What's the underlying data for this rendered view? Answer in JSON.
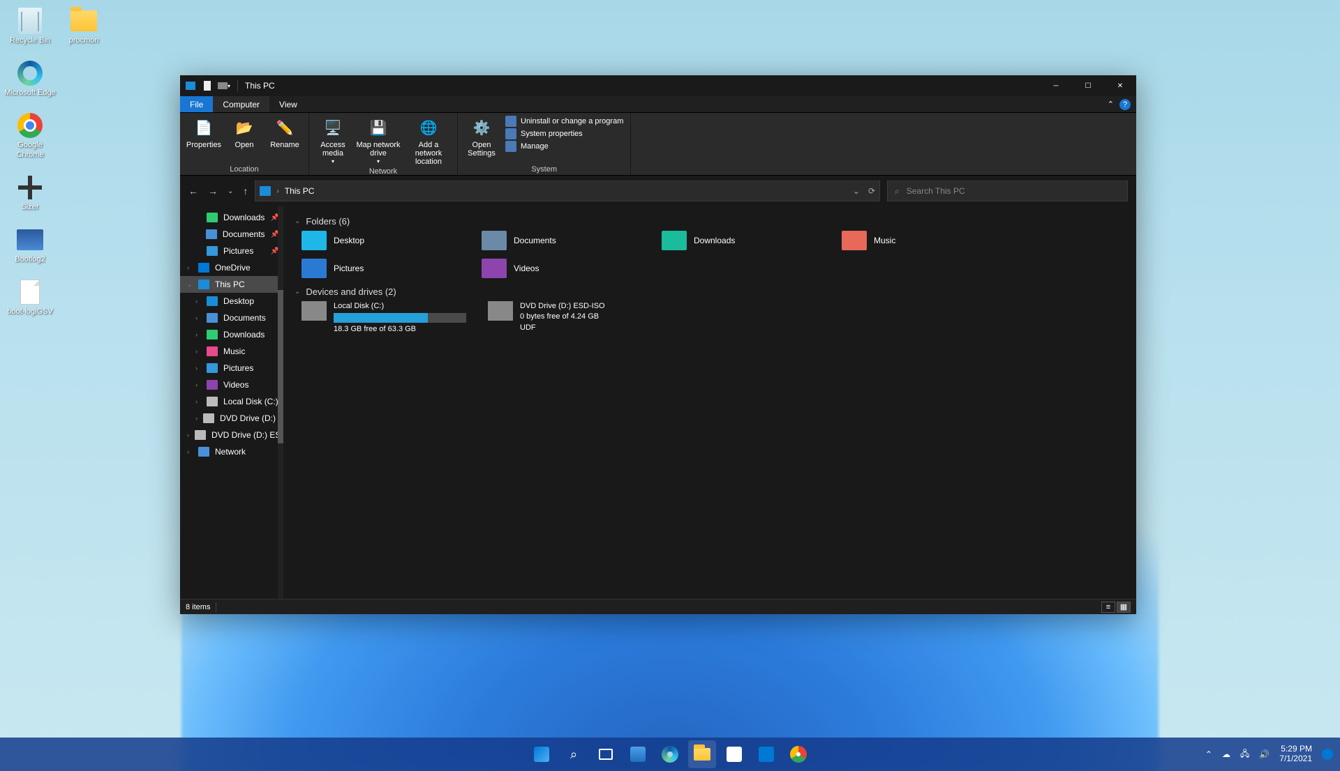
{
  "desktop": {
    "icons_col1": [
      {
        "label": "Recycle Bin",
        "type": "recycle"
      },
      {
        "label": "Microsoft Edge",
        "type": "edge"
      },
      {
        "label": "Google Chrome",
        "type": "chrome"
      },
      {
        "label": "Sizer",
        "type": "sizer"
      },
      {
        "label": "Bootlog2",
        "type": "bootlog"
      },
      {
        "label": "boot-logiGSV",
        "type": "file"
      }
    ],
    "icons_col2": [
      {
        "label": "procmon",
        "type": "folder"
      }
    ]
  },
  "explorer": {
    "title": "This PC",
    "tabs": {
      "file": "File",
      "computer": "Computer",
      "view": "View"
    },
    "ribbon": {
      "location": {
        "label": "Location",
        "buttons": [
          "Properties",
          "Open",
          "Rename"
        ]
      },
      "network": {
        "label": "Network",
        "buttons": [
          "Access media",
          "Map network drive",
          "Add a network location"
        ]
      },
      "system": {
        "label": "System",
        "open_settings": "Open Settings",
        "small": [
          "Uninstall or change a program",
          "System properties",
          "Manage"
        ]
      }
    },
    "address": {
      "crumb": "This PC",
      "search_placeholder": "Search This PC"
    },
    "sidebar": [
      {
        "label": "Downloads",
        "ico": "#2ecc71",
        "indent": 1,
        "pin": true,
        "chev": ""
      },
      {
        "label": "Documents",
        "ico": "#4a90d9",
        "indent": 1,
        "pin": true,
        "chev": ""
      },
      {
        "label": "Pictures",
        "ico": "#3498db",
        "indent": 1,
        "pin": true,
        "chev": ""
      },
      {
        "label": "OneDrive",
        "ico": "#0078d4",
        "indent": 0,
        "chev": "›"
      },
      {
        "label": "This PC",
        "ico": "#1a8cd8",
        "indent": 0,
        "selected": true,
        "chev": "⌄"
      },
      {
        "label": "Desktop",
        "ico": "#1a8cd8",
        "indent": 1,
        "chev": "›"
      },
      {
        "label": "Documents",
        "ico": "#4a90d9",
        "indent": 1,
        "chev": "›"
      },
      {
        "label": "Downloads",
        "ico": "#2ecc71",
        "indent": 1,
        "chev": "›"
      },
      {
        "label": "Music",
        "ico": "#e84a8a",
        "indent": 1,
        "chev": "›"
      },
      {
        "label": "Pictures",
        "ico": "#3498db",
        "indent": 1,
        "chev": "›"
      },
      {
        "label": "Videos",
        "ico": "#8e44ad",
        "indent": 1,
        "chev": "›"
      },
      {
        "label": "Local Disk (C:)",
        "ico": "#bbb",
        "indent": 1,
        "chev": "›"
      },
      {
        "label": "DVD Drive (D:) E",
        "ico": "#bbb",
        "indent": 1,
        "chev": "›"
      },
      {
        "label": "DVD Drive (D:) ES",
        "ico": "#bbb",
        "indent": 0,
        "chev": "›"
      },
      {
        "label": "Network",
        "ico": "#4a90d9",
        "indent": 0,
        "chev": "›"
      }
    ],
    "folders_header": "Folders (6)",
    "folders": [
      {
        "label": "Desktop",
        "color": "#1fb6e8"
      },
      {
        "label": "Documents",
        "color": "#6a8aa8"
      },
      {
        "label": "Downloads",
        "color": "#1abc9c"
      },
      {
        "label": "Music",
        "color": "#e8685a"
      },
      {
        "label": "Pictures",
        "color": "#2a7ad4"
      },
      {
        "label": "Videos",
        "color": "#8e44ad"
      }
    ],
    "drives_header": "Devices and drives (2)",
    "drives": [
      {
        "label": "Local Disk (C:)",
        "sub": "18.3 GB free of 63.3 GB",
        "fill": 71
      },
      {
        "label": "DVD Drive (D:) ESD-ISO",
        "sub": "0 bytes free of 4.24 GB",
        "sub2": "UDF"
      }
    ],
    "status": "8 items"
  },
  "taskbar": {
    "time": "5:29 PM",
    "date": "7/1/2021"
  }
}
